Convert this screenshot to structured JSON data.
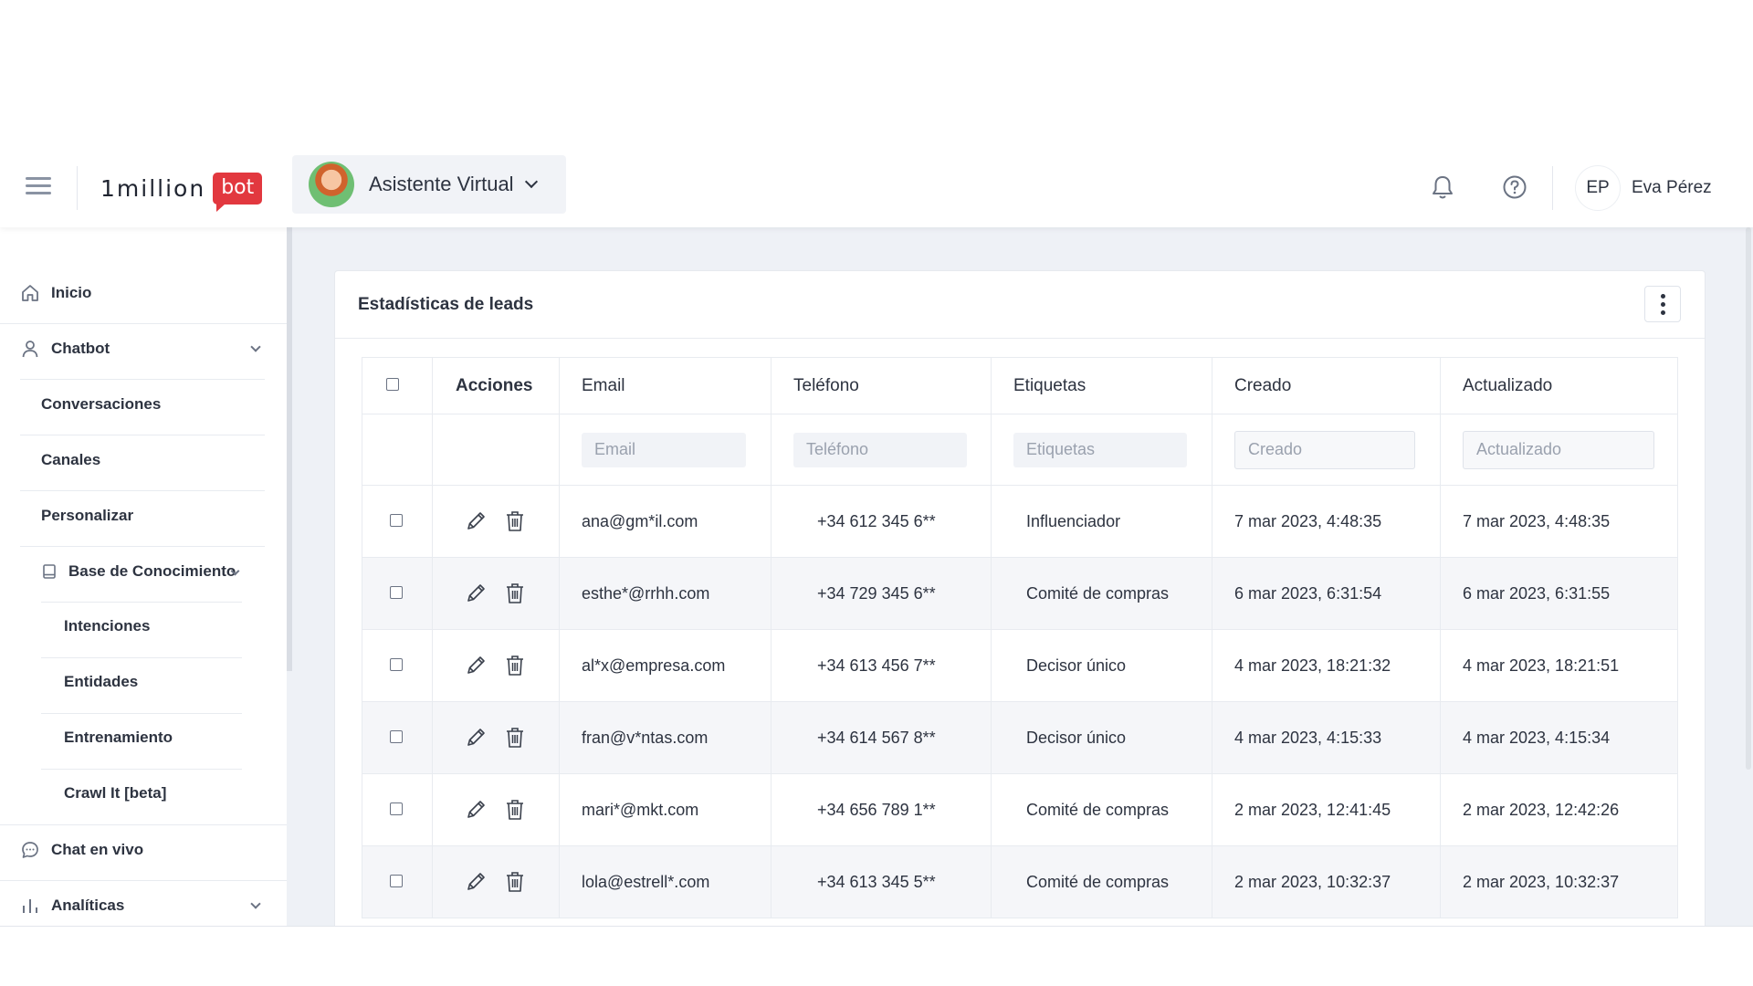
{
  "header": {
    "logo_text": "1million",
    "logo_badge": "bot",
    "bot_name": "Asistente Virtual",
    "user_initials": "EP",
    "user_name": "Eva Pérez"
  },
  "sidebar": {
    "inicio": "Inicio",
    "chatbot": "Chatbot",
    "conversaciones": "Conversaciones",
    "canales": "Canales",
    "personalizar": "Personalizar",
    "base_conocimiento": "Base de Conocimiento",
    "intenciones": "Intenciones",
    "entidades": "Entidades",
    "entrenamiento": "Entrenamiento",
    "crawl": "Crawl It [beta]",
    "chat_vivo": "Chat en vivo",
    "analiticas": "Analíticas"
  },
  "card": {
    "title": "Estadísticas de leads"
  },
  "table": {
    "headers": {
      "acciones": "Acciones",
      "email": "Email",
      "telefono": "Teléfono",
      "etiquetas": "Etiquetas",
      "creado": "Creado",
      "actualizado": "Actualizado"
    },
    "placeholders": {
      "email": "Email",
      "telefono": "Teléfono",
      "etiquetas": "Etiquetas",
      "creado": "Creado",
      "actualizado": "Actualizado"
    },
    "rows": [
      {
        "email": "ana@gm*il.com",
        "telefono": "+34 612 345 6**",
        "etiquetas": "Influenciador",
        "creado": "7 mar 2023, 4:48:35",
        "actualizado": "7 mar 2023, 4:48:35"
      },
      {
        "email": "esthe*@rrhh.com",
        "telefono": "+34 729 345 6**",
        "etiquetas": "Comité de compras",
        "creado": "6 mar 2023, 6:31:54",
        "actualizado": "6 mar 2023, 6:31:55"
      },
      {
        "email": "al*x@empresa.com",
        "telefono": "+34 613 456 7**",
        "etiquetas": "Decisor único",
        "creado": "4 mar 2023, 18:21:32",
        "actualizado": "4 mar 2023, 18:21:51"
      },
      {
        "email": "fran@v*ntas.com",
        "telefono": "+34 614 567 8**",
        "etiquetas": "Decisor único",
        "creado": "4 mar 2023, 4:15:33",
        "actualizado": "4 mar 2023, 4:15:34"
      },
      {
        "email": "mari*@mkt.com",
        "telefono": "+34 656 789 1**",
        "etiquetas": "Comité de compras",
        "creado": "2 mar 2023, 12:41:45",
        "actualizado": "2 mar 2023, 12:42:26"
      },
      {
        "email": "lola@estrell*.com",
        "telefono": "+34 613 345 5**",
        "etiquetas": "Comité de compras",
        "creado": "2 mar 2023, 10:32:37",
        "actualizado": "2 mar 2023, 10:32:37"
      }
    ]
  }
}
